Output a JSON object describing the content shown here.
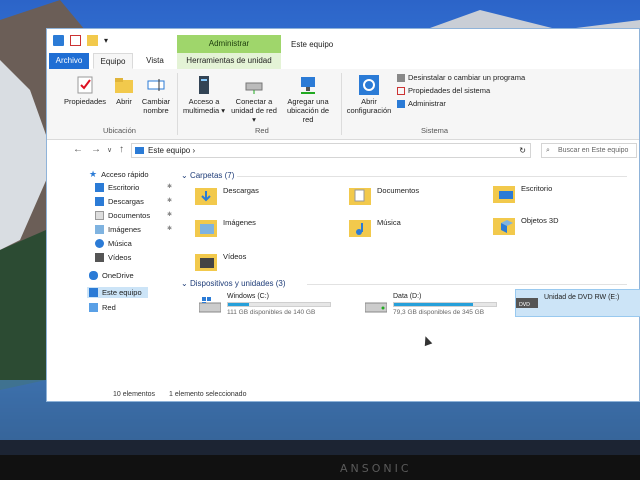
{
  "window": {
    "title": "Este equipo",
    "context_tab_title": "Administrar"
  },
  "tabs": [
    {
      "label": "Archivo"
    },
    {
      "label": "Equipo"
    },
    {
      "label": "Vista"
    },
    {
      "label": "Herramientas de unidad"
    }
  ],
  "ribbon": {
    "ubicacion": {
      "label": "Ubicación",
      "buttons": [
        "Propiedades",
        "Abrir",
        "Cambiar nombre"
      ]
    },
    "red": {
      "label": "Red",
      "buttons": [
        "Acceso a multimedia ▾",
        "Conectar a unidad de red ▾",
        "Agregar una ubicación de red"
      ]
    },
    "sistema": {
      "label": "Sistema",
      "open_config": "Abrir configuración",
      "items": [
        "Desinstalar o cambiar un programa",
        "Propiedades del sistema",
        "Administrar"
      ]
    }
  },
  "address": {
    "path": "Este equipo",
    "search_placeholder": "Buscar en Este equipo"
  },
  "nav": {
    "quick_access": "Acceso rápido",
    "items": [
      "Escritorio",
      "Descargas",
      "Documentos",
      "Imágenes",
      "Música",
      "Vídeos"
    ],
    "onedrive": "OneDrive",
    "this_pc": "Este equipo",
    "network": "Red"
  },
  "content": {
    "folders_title": "Carpetas (7)",
    "folders": [
      "Descargas",
      "Documentos",
      "Escritorio",
      "Imágenes",
      "Música",
      "Objetos 3D",
      "Vídeos"
    ],
    "drives_title": "Dispositivos y unidades (3)",
    "drives": [
      {
        "name": "Windows (C:)",
        "free": "111 GB disponibles de 140 GB",
        "used_fraction": 0.21
      },
      {
        "name": "Data (D:)",
        "free": "79,3 GB disponibles de 345 GB",
        "used_fraction": 0.77
      },
      {
        "name": "Unidad de DVD RW (E:)"
      }
    ]
  },
  "status": {
    "items": "10 elementos",
    "selected": "1 elemento seleccionado"
  },
  "monitor": {
    "brand": "ANSONIC"
  },
  "colors": {
    "accent": "#1f6ed4",
    "context_tab": "#9fd66b",
    "drive_bar": "#26a0da",
    "selection": "#cce4f7"
  }
}
